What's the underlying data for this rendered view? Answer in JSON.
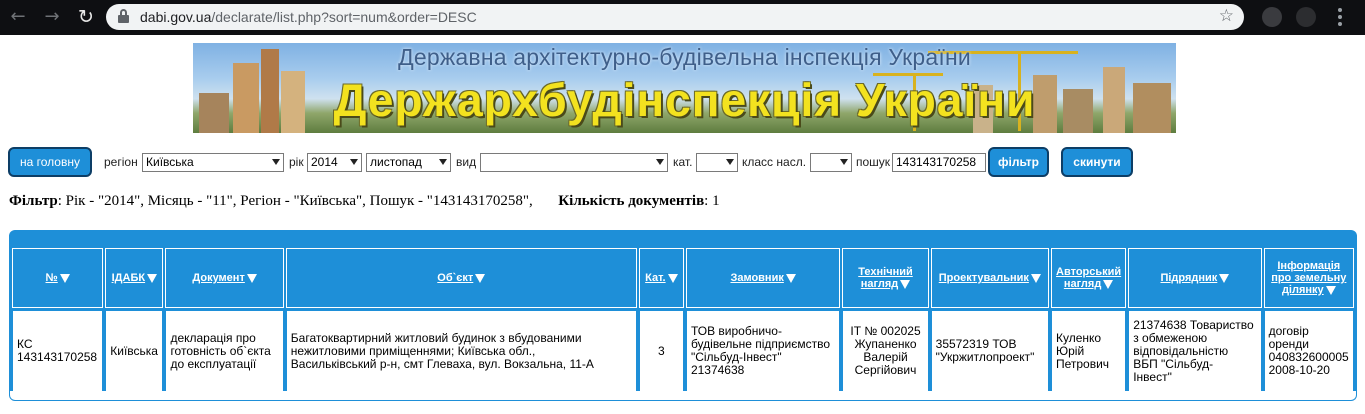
{
  "browser": {
    "url_domain": "dabi.gov.ua",
    "url_path": "/declarate/list.php?sort=num&order=DESC"
  },
  "banner": {
    "subtitle": "Державна архітектурно-будівельна інспекція України",
    "title": "Держархбудінспекція України"
  },
  "filters": {
    "home_button": "на головну",
    "region_label": "регіон",
    "region_value": "Київська",
    "year_label": "рік",
    "year_value": "2014",
    "month_value": "листопад",
    "type_label": "вид",
    "type_value": "",
    "cat_label": "кат.",
    "cat_value": "",
    "class_label": "класс насл.",
    "class_value": "",
    "search_label": "пошук",
    "search_value": "143143170258",
    "filter_button": "фільтр",
    "reset_button": "скинути"
  },
  "summary": {
    "filter_label": "Фільтр",
    "filter_text": ": Рік - \"2014\", Місяць - \"11\", Регіон - \"Київська\", Пошук - \"143143170258\",",
    "count_label": "Кількість документів",
    "count_value": ": 1"
  },
  "table": {
    "headers": {
      "num": "№",
      "idabk": "ІДАБК",
      "document": "Документ",
      "object": "Об`єкт",
      "cat": "Кат.",
      "customer": "Замовник",
      "tech_sup_1": "Технічний",
      "tech_sup_2": "нагляд",
      "designer": "Проектувальник",
      "author_sup_1": "Авторський",
      "author_sup_2": "нагляд",
      "contractor": "Підрядник",
      "land_1": "Інформація",
      "land_2": "про земельну",
      "land_3": "ділянку"
    },
    "row": {
      "num_1": "КС",
      "num_2": "143143170258",
      "idabk": "Київська",
      "document_1": "декларація про",
      "document_2": "готовність об`єкта",
      "document_3": "до експлуатації",
      "object_1": "Багатоквартирний житловий будинок з вбудованими",
      "object_2": "нежитловими приміщеннями; Київська обл.,",
      "object_3": "Васильківський р-н, смт Глеваха, вул. Вокзальна, 11-А",
      "cat": "3",
      "customer_1": "ТОВ виробничо-",
      "customer_2": "будівельне підприємство",
      "customer_3": "\"Сільбуд-Інвест\"",
      "customer_4": "21374638",
      "tech_1": "ІТ № 002025",
      "tech_2": "Жупаненко",
      "tech_3": "Валерій",
      "tech_4": "Сергійович",
      "designer_1": "35572319 ТОВ",
      "designer_2": "\"Укржитлопроект\"",
      "author_1": "Куленко",
      "author_2": "Юрій",
      "author_3": "Петрович",
      "contractor_1": "21374638 Товариство",
      "contractor_2": "з обмеженою",
      "contractor_3": "відповідальністю",
      "contractor_4": "ВБП \"Сільбуд-",
      "contractor_5": "Інвест\"",
      "land_1": "договір",
      "land_2": "оренди",
      "land_3": "040832600005",
      "land_4": "2008-10-20"
    }
  }
}
